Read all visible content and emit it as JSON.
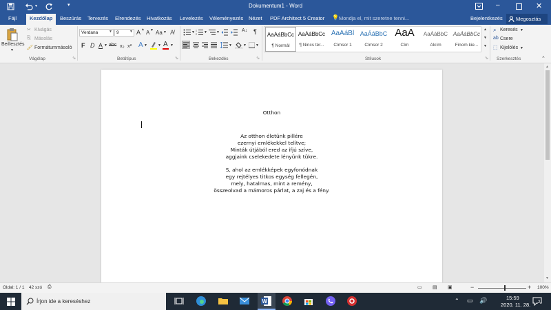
{
  "titlebar": {
    "title": "Dokumentum1 - Word",
    "save_icon": "save-icon",
    "undo_icon": "undo-icon",
    "redo_icon": "redo-icon",
    "customize_icon": "customize-icon"
  },
  "menubar": {
    "tabs": [
      "Fájl",
      "Kezdőlap",
      "Beszúrás",
      "Tervezés",
      "Elrendezés",
      "Hivatkozás",
      "Levelezés",
      "Véleményezés",
      "Nézet",
      "PDF Architect 5 Creator"
    ],
    "active_tab": "Kezdőlap",
    "tell_me": "Mondja el, mit szeretne tenni...",
    "sign_in": "Bejelentkezés",
    "share": "Megosztás"
  },
  "ribbon": {
    "clipboard": {
      "paste": "Beillesztés",
      "cut": "Kivágás",
      "copy": "Másolás",
      "format_painter": "Formátummásoló",
      "label": "Vágólap"
    },
    "font": {
      "font_name": "Verdana",
      "font_size": "9",
      "bold": "F",
      "italic": "D",
      "underline": "A",
      "strike": "abc",
      "subscript": "x₂",
      "superscript": "x²",
      "grow": "A",
      "shrink": "A",
      "case": "Aa",
      "label": "Betűtípus"
    },
    "paragraph": {
      "label": "Bekezdés",
      "pilcrow": "¶"
    },
    "styles": {
      "label": "Stílusok",
      "items": [
        {
          "sample": "AaÁáBbCc",
          "name": "¶ Normál"
        },
        {
          "sample": "AaÁáBbCc",
          "name": "¶ Nincs tér..."
        },
        {
          "sample": "AaÁáBl",
          "name": "Címsor 1"
        },
        {
          "sample": "AaÁáBbC",
          "name": "Címsor 2"
        },
        {
          "sample": "AaA",
          "name": "Cím"
        },
        {
          "sample": "AaÁáBbC",
          "name": "Alcím"
        },
        {
          "sample": "AaÁáBbCc",
          "name": "Finom kie..."
        }
      ]
    },
    "editing": {
      "find": "Keresés",
      "replace": "Csere",
      "select": "Kijelölés",
      "label": "Szerkesztés"
    }
  },
  "document": {
    "title": "Otthon",
    "stanza1": [
      "Az otthon életünk pillére",
      "ezernyi emlékekkel telítve;",
      "Minták útjából ered az ifjú szíve,",
      "aggjaink cselekedete lényünk tükre."
    ],
    "stanza2": [
      "S, ahol az emlékképek egyfonódnak",
      "egy rejtélyes titkos egység fellegén,",
      "mely, hatalmas, mint a remény,",
      "összeolvad a mámoros párlat, a zaj és a fény."
    ]
  },
  "status": {
    "page": "Oldal: 1 / 1",
    "words": "42 szó",
    "zoom": "100%"
  },
  "taskbar": {
    "search_placeholder": "Írjon ide a kereséshez",
    "time": "15:59",
    "date": "2020. 11. 28.",
    "notifications": "2"
  },
  "colors": {
    "word_blue": "#2b579a",
    "taskbar": "#1f2a36",
    "highlight": "#ffff00",
    "font_color": "#e00000"
  }
}
